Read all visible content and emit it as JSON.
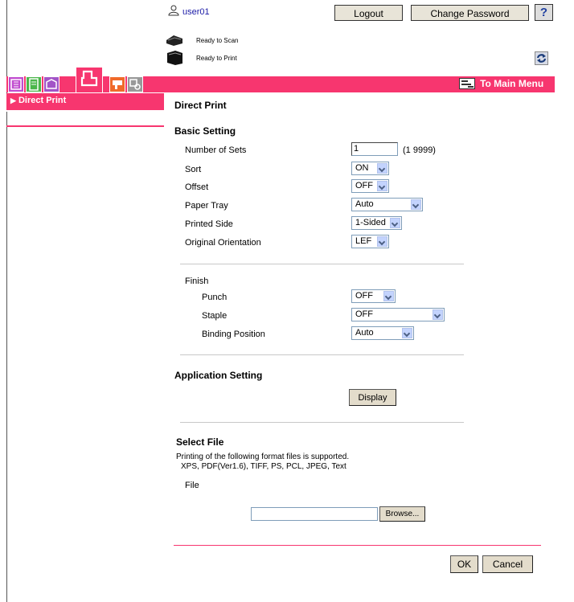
{
  "header": {
    "user": "user01",
    "logout_label": "Logout",
    "change_password_label": "Change Password",
    "help_label": "?"
  },
  "status": {
    "scan": "Ready to Scan",
    "print": "Ready to Print"
  },
  "tabbar": {
    "main_menu_label": "To Main Menu",
    "accent_color": "#f7366f"
  },
  "sidebar": {
    "items": [
      {
        "label": "Direct Print"
      }
    ]
  },
  "main": {
    "title": "Direct Print",
    "basic": {
      "heading": "Basic Setting",
      "number_of_sets_label": "Number of Sets",
      "number_of_sets_value": "1",
      "number_of_sets_range": "(1 ︎9999)",
      "sort_label": "Sort",
      "sort_value": "ON",
      "offset_label": "Offset",
      "offset_value": "OFF",
      "paper_tray_label": "Paper Tray",
      "paper_tray_value": "Auto",
      "printed_side_label": "Printed Side",
      "printed_side_value": "1-Sided",
      "orientation_label": "Original Orientation",
      "orientation_value": "LEF"
    },
    "finish": {
      "heading": "Finish",
      "punch_label": "Punch",
      "punch_value": "OFF",
      "staple_label": "Staple",
      "staple_value": "OFF",
      "binding_label": "Binding Position",
      "binding_value": "Auto"
    },
    "application": {
      "heading": "Application Setting",
      "display_label": "Display"
    },
    "select_file": {
      "heading": "Select File",
      "note1": "Printing of the following format files is supported.",
      "note2": "XPS, PDF(Ver1.6), TIFF, PS, PCL, JPEG, Text",
      "file_label": "File",
      "file_value": "",
      "browse_label": "Browse..."
    },
    "ok_label": "OK",
    "cancel_label": "Cancel"
  }
}
